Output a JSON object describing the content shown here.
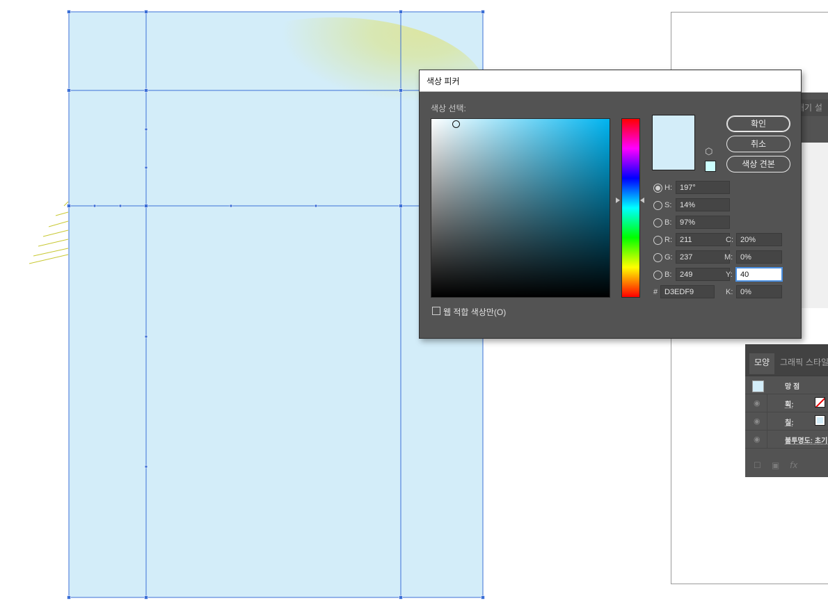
{
  "dialog": {
    "title": "색상 피커",
    "select_label": "색상 선택:",
    "buttons": {
      "ok": "확인",
      "cancel": "취소",
      "swatches": "색상 견본"
    },
    "current_color": "#D3EDF9",
    "hue_color": "#00B4F0",
    "hsb": [
      {
        "label": "H:",
        "value": "197°",
        "selected": true
      },
      {
        "label": "S:",
        "value": "14%",
        "selected": false
      },
      {
        "label": "B:",
        "value": "97%",
        "selected": false
      }
    ],
    "rgb": [
      {
        "label": "R:",
        "value": "211"
      },
      {
        "label": "G:",
        "value": "237"
      },
      {
        "label": "B:",
        "value": "249"
      }
    ],
    "hex": {
      "label": "#",
      "value": "D3EDF9"
    },
    "cmyk": [
      {
        "label": "C:",
        "value": "20%"
      },
      {
        "label": "M:",
        "value": "0%"
      },
      {
        "label": "Y:",
        "value": "40",
        "focused": true
      },
      {
        "label": "K:",
        "value": "0%"
      }
    ],
    "websafe_only": {
      "label": "웹 적합 색상만(O)",
      "checked": false
    }
  },
  "background_panel": {
    "tab_label": "배기  설"
  },
  "appearance_panel": {
    "tabs": [
      "모양",
      "그래픽 스타일"
    ],
    "object_label": "망 점",
    "rows": [
      {
        "label": "획:",
        "swatch": "none"
      },
      {
        "label": "칠:",
        "swatch": "#D3EDF9"
      },
      {
        "label": "불투명도: 초기",
        "swatch": ""
      }
    ],
    "footer_icons": [
      "new-stroke-icon",
      "new-fill-icon",
      "fx-icon"
    ]
  },
  "artwork": {
    "fill_color": "#D3EDF9",
    "glow_color": "#D8E6A8",
    "mesh_line_color": "#3B6FD6",
    "stray_line_color": "#C8C832"
  }
}
